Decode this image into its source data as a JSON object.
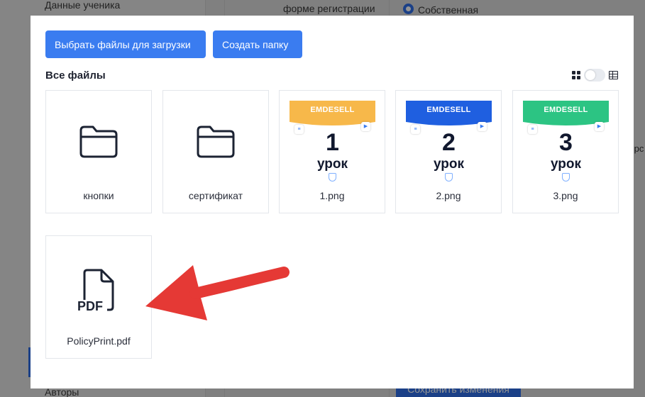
{
  "background": {
    "sidebar_top": "Данные ученика",
    "sidebar_bottom": "Авторы",
    "field_label": "форме регистрации",
    "radio_label": "Собственная",
    "save_button": "Сохранить изменения",
    "cut_text": ".рс"
  },
  "modal": {
    "upload_button": "Выбрать файлы для загрузки",
    "create_folder_button": "Создать папку",
    "title": "Все файлы",
    "view": {
      "grid_icon": "grid-icon",
      "table_icon": "table-icon",
      "toggle_state": "grid"
    },
    "items": [
      {
        "type": "folder",
        "name": "кнопки",
        "icon": "folder-icon"
      },
      {
        "type": "folder",
        "name": "сертификат",
        "icon": "folder-icon"
      },
      {
        "type": "image",
        "name": "1.png",
        "brand": "EMDESELL",
        "number": "1",
        "word": "урок",
        "accent": "#f7b84a"
      },
      {
        "type": "image",
        "name": "2.png",
        "brand": "EMDESELL",
        "number": "2",
        "word": "урок",
        "accent": "#1f5fe0"
      },
      {
        "type": "image",
        "name": "3.png",
        "brand": "EMDESELL",
        "number": "3",
        "word": "урок",
        "accent": "#2cc483"
      },
      {
        "type": "pdf",
        "name": "PolicyPrint.pdf",
        "icon": "pdf-file-icon",
        "icon_text": "PDF"
      }
    ]
  },
  "annotation": {
    "arrow_color": "#e53935",
    "arrow_icon": "red-arrow-icon"
  }
}
